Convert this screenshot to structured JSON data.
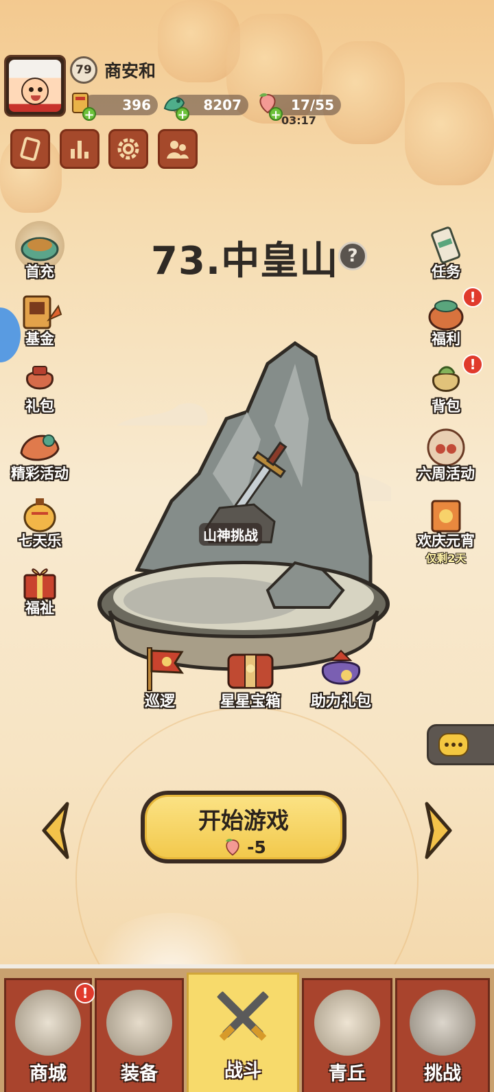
{
  "player": {
    "level": "79",
    "name": "商安和"
  },
  "resources": [
    {
      "icon": "gold-ingot-icon",
      "value": "396"
    },
    {
      "icon": "jade-dragon-icon",
      "value": "8207"
    },
    {
      "icon": "peach-stamina-icon",
      "value": "17/55"
    }
  ],
  "stamina_timer": "03:17",
  "quick_buttons": [
    "card-icon",
    "ranking-icon",
    "settings-gear-icon",
    "friends-icon"
  ],
  "stage": {
    "title": "73.中皇山",
    "help": "?",
    "challenge_label": "山神挑战",
    "sub_items": [
      {
        "label": "巡逻",
        "icon": "patrol-flag-icon"
      },
      {
        "label": "星星宝箱",
        "icon": "star-chest-icon"
      },
      {
        "label": "助力礼包",
        "icon": "support-pack-icon"
      }
    ]
  },
  "left_menu": [
    {
      "label": "首充",
      "icon": "first-recharge-icon"
    },
    {
      "label": "基金",
      "icon": "fund-icon"
    },
    {
      "label": "礼包",
      "icon": "gift-bag-icon"
    },
    {
      "label": "精彩活动",
      "icon": "events-icon"
    },
    {
      "label": "七天乐",
      "icon": "seven-day-icon"
    },
    {
      "label": "福祉",
      "icon": "blessing-gift-icon"
    }
  ],
  "right_menu": [
    {
      "label": "任务",
      "icon": "task-scroll-icon",
      "alert": false
    },
    {
      "label": "福利",
      "icon": "welfare-icon",
      "alert": true
    },
    {
      "label": "背包",
      "icon": "backpack-icon",
      "alert": true
    },
    {
      "label": "六周活动",
      "icon": "six-week-event-icon",
      "alert": false
    },
    {
      "label": "欢庆元宵",
      "icon": "lantern-festival-icon",
      "alert": false,
      "sub": "仅剩2天"
    }
  ],
  "alert_mark": "!",
  "start": {
    "label": "开始游戏",
    "cost": "-5"
  },
  "bottom_nav": [
    {
      "label": "商城",
      "icon": "shop-icon",
      "alert": true
    },
    {
      "label": "装备",
      "icon": "equipment-helmet-icon",
      "alert": false
    },
    {
      "label": "战斗",
      "icon": "battle-swords-icon",
      "alert": false,
      "active": true
    },
    {
      "label": "青丘",
      "icon": "qingqiu-mountain-icon",
      "alert": false
    },
    {
      "label": "挑战",
      "icon": "challenge-orb-icon",
      "alert": false
    }
  ],
  "colors": {
    "nav_tab": "#a9442d",
    "nav_active": "#f7da6b",
    "start_button": "#f2c94c",
    "alert": "#e03a2c"
  }
}
